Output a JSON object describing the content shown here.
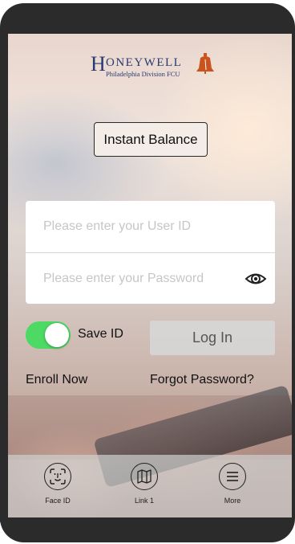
{
  "brand": {
    "initial": "H",
    "name": "ONEYWELL",
    "subtitle": "Philadelphia Division FCU",
    "logo_color": "#2a3970",
    "bell_color": "#c9541f"
  },
  "instant_balance": {
    "label": "Instant Balance"
  },
  "login_form": {
    "user_id": {
      "placeholder": "Please enter your User ID",
      "value": ""
    },
    "password": {
      "placeholder": "Please enter your Password",
      "value": ""
    },
    "save_id": {
      "label": "Save ID",
      "enabled": true
    },
    "login_label": "Log In"
  },
  "links": {
    "enroll": "Enroll Now",
    "forgot": "Forgot Password?"
  },
  "tab_bar": {
    "items": [
      {
        "label": "Face ID",
        "icon": "face-id-icon"
      },
      {
        "label": "Link 1",
        "icon": "map-icon"
      },
      {
        "label": "More",
        "icon": "menu-icon"
      }
    ]
  },
  "colors": {
    "toggle_on": "#4cd964",
    "side_accent": "#2f55a0"
  }
}
